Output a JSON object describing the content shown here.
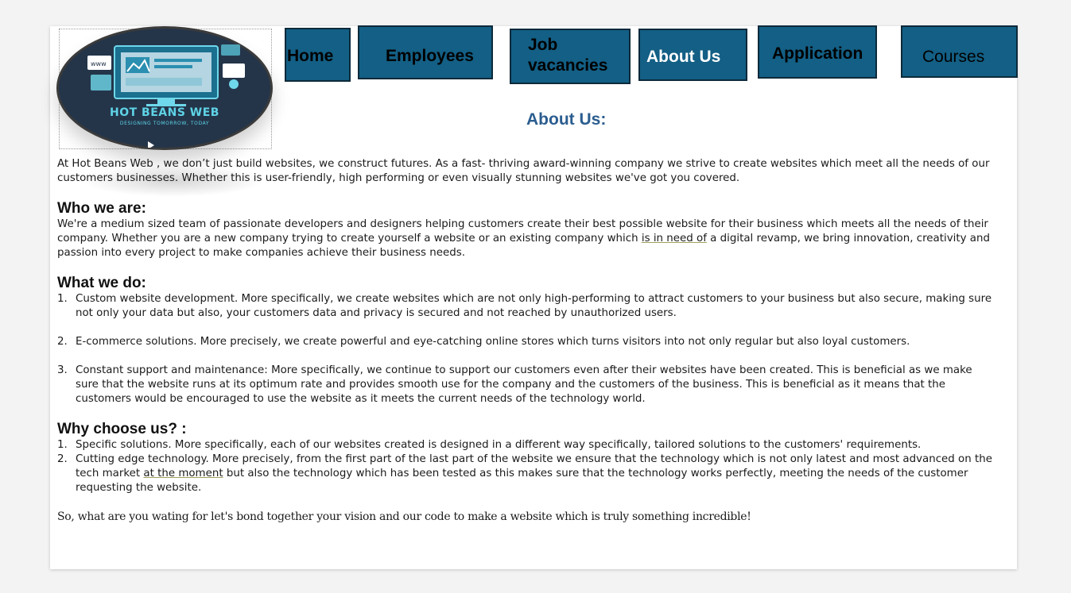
{
  "logo": {
    "name": "HOT BEANS WEB",
    "tagline": "DESIGNING TOMORROW, TODAY"
  },
  "nav": {
    "home": "Home",
    "employees": "Employees",
    "jobs": "Job vacancies",
    "about": "About Us",
    "application": "Application",
    "courses": "Courses"
  },
  "page_title": "About Us:",
  "intro": "At Hot Beans Web , we don’t just build websites, we construct futures. As a fast- thriving award-winning company we strive to create websites which meet all the needs of our customers businesses. Whether this is user-friendly, high performing or even visually stunning websites  we've got you covered.",
  "who": {
    "heading": "Who we are:",
    "text_before": "We're a medium sized team of passionate developers and designers helping customers create their best possible website for their business which meets all the needs of their company. Whether you are a new company trying to create yourself a website or an existing company which ",
    "text_underlined": "is in need of",
    "text_after": " a digital revamp, we bring innovation, creativity and passion into every project to make companies achieve their business needs."
  },
  "what": {
    "heading": "What we do:",
    "items": [
      {
        "num": "1.",
        "text": "Custom website development. More specifically, we create websites which are not only high-performing to attract customers to your business but also secure, making sure not only your data but also, your customers data and privacy is secured and not reached by unauthorized users."
      },
      {
        "num": "2.",
        "text": "E-commerce solutions. More precisely, we create powerful and eye-catching online stores which turns visitors into not only regular but also loyal customers."
      },
      {
        "num": "3.",
        "text": "Constant support and maintenance: More specifically, we continue to support our customers even after their websites have been created. This is beneficial as we make sure that the website runs at its optimum rate and provides smooth use for the company and the customers of the business. This is beneficial as it means that the customers would be encouraged to use the website as it meets the current needs of the technology world."
      }
    ]
  },
  "why": {
    "heading": "Why choose us? :",
    "item1_num": "1.",
    "item1_text": "Specific solutions. More specifically, each of our websites created is designed in a different way specifically, tailored solutions to the customers' requirements.",
    "item2_num": "2.",
    "item2_before": "Cutting edge technology. More precisely, from the first part of the last part of the website we ensure that the technology which is not only latest and most advanced on the tech market ",
    "item2_underlined": "at the moment",
    "item2_after": " but also the technology which has been tested as this makes sure that the technology works perfectly, meeting the needs of the customer requesting the website."
  },
  "closing": "So, what are you wating for let's bond together your vision and our code to make a website which is truly something incredible!",
  "colors": {
    "nav_button": "#135f85",
    "nav_border": "#0d2a3a",
    "title": "#2b5d8f",
    "logo_accent": "#5fd3e6"
  }
}
